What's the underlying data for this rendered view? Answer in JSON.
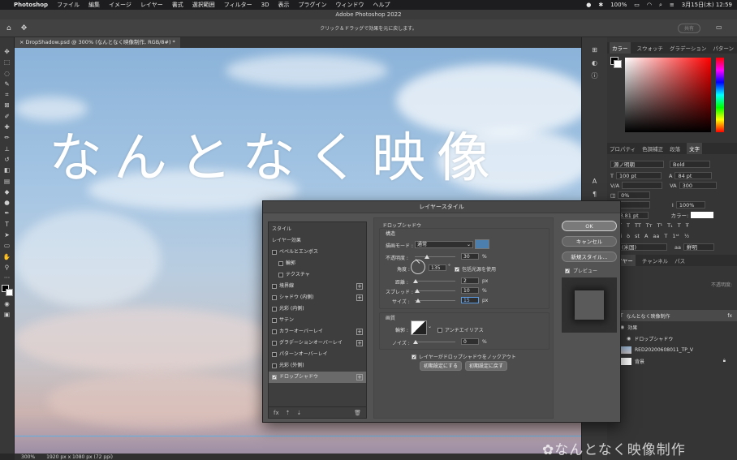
{
  "menubar": {
    "app": "Photoshop",
    "items": [
      "ファイル",
      "編集",
      "イメージ",
      "レイヤー",
      "書式",
      "選択範囲",
      "フィルター",
      "3D",
      "表示",
      "プラグイン",
      "ウィンドウ",
      "ヘルプ"
    ],
    "battery": "100%",
    "clock": "3月15日(木)  12:59"
  },
  "window": {
    "title": "Adobe Photoshop 2022"
  },
  "options": {
    "hint": "クリック＆ドラッグで効果を元に戻します。",
    "share": "共有"
  },
  "document": {
    "tab": "DropShadow.psd @ 300% (なんとなく映像制作, RGB/8#) *"
  },
  "canvas": {
    "text": "なんとなく映像"
  },
  "status": {
    "zoom": "300%",
    "info": "1920 px x 1080 px (72 ppi)"
  },
  "color_panel": {
    "tabs": [
      "カラー",
      "スウォッチ",
      "グラデーション",
      "パターン"
    ]
  },
  "char_panel": {
    "tabs": [
      "プロパティ",
      "色調補正",
      "段落",
      "文字"
    ],
    "font": "源ノ明朝",
    "style": "Bold",
    "size": "100 pt",
    "leading": "84 pt",
    "tracking": "300",
    "kerning": "0%",
    "scale_h": "100%",
    "baseline": "3.81 pt",
    "color_label": "カラー:",
    "lang": "(米国)",
    "aa": "鮮明"
  },
  "layers_panel": {
    "tabs": [
      "レイヤー",
      "チャンネル",
      "パス"
    ],
    "opacity": "不透明度:",
    "rows": [
      {
        "label": "なんとなく映像制作",
        "fx": "fx"
      },
      {
        "label": "効果"
      },
      {
        "label": "ドロップシャドウ"
      },
      {
        "label": "RED20200608011_TP_V"
      },
      {
        "label": "背景"
      }
    ]
  },
  "dialog": {
    "title": "レイヤースタイル",
    "style_header": "スタイル",
    "effects_header": "レイヤー効果",
    "effects": [
      {
        "label": "ベベルとエンボス",
        "checked": false,
        "plus": false
      },
      {
        "label": "輪郭",
        "checked": false,
        "plus": false,
        "indent": true
      },
      {
        "label": "テクスチャ",
        "checked": false,
        "plus": false,
        "indent": true
      },
      {
        "label": "境界線",
        "checked": false,
        "plus": true
      },
      {
        "label": "シャドウ (内側)",
        "checked": false,
        "plus": true
      },
      {
        "label": "光彩 (内側)",
        "checked": false,
        "plus": false
      },
      {
        "label": "サテン",
        "checked": false,
        "plus": false
      },
      {
        "label": "カラーオーバーレイ",
        "checked": false,
        "plus": true
      },
      {
        "label": "グラデーションオーバーレイ",
        "checked": false,
        "plus": true
      },
      {
        "label": "パターンオーバーレイ",
        "checked": false,
        "plus": false
      },
      {
        "label": "光彩 (外側)",
        "checked": false,
        "plus": false
      },
      {
        "label": "ドロップシャドウ",
        "checked": true,
        "plus": true
      }
    ],
    "section_title": "ドロップシャドウ",
    "structure": "構造",
    "blend_label": "描画モード :",
    "blend_value": "通常",
    "shadow_color": "#4d7fae",
    "opacity_label": "不透明度 :",
    "opacity_value": "30",
    "angle_label": "角度 :",
    "angle_value": "135",
    "global_light": "包括光源を使用",
    "distance_label": "距離 :",
    "distance_value": "2",
    "spread_label": "スプレッド :",
    "spread_value": "10",
    "size_label": "サイズ :",
    "size_value": "15",
    "unit_px": "px",
    "unit_pct": "%",
    "quality": "画質",
    "contour_label": "輪郭 :",
    "antialias": "アンチエイリアス",
    "noise_label": "ノイズ :",
    "noise_value": "0",
    "knockout": "レイヤーがドロップシャドウをノックアウト",
    "make_default": "初期設定にする",
    "reset_default": "初期設定に戻す",
    "ok": "OK",
    "cancel": "キャンセル",
    "new_style": "新規スタイル...",
    "preview": "プレビュー",
    "foot_fx": "fx"
  },
  "watermark": "なんとなく映像制作"
}
